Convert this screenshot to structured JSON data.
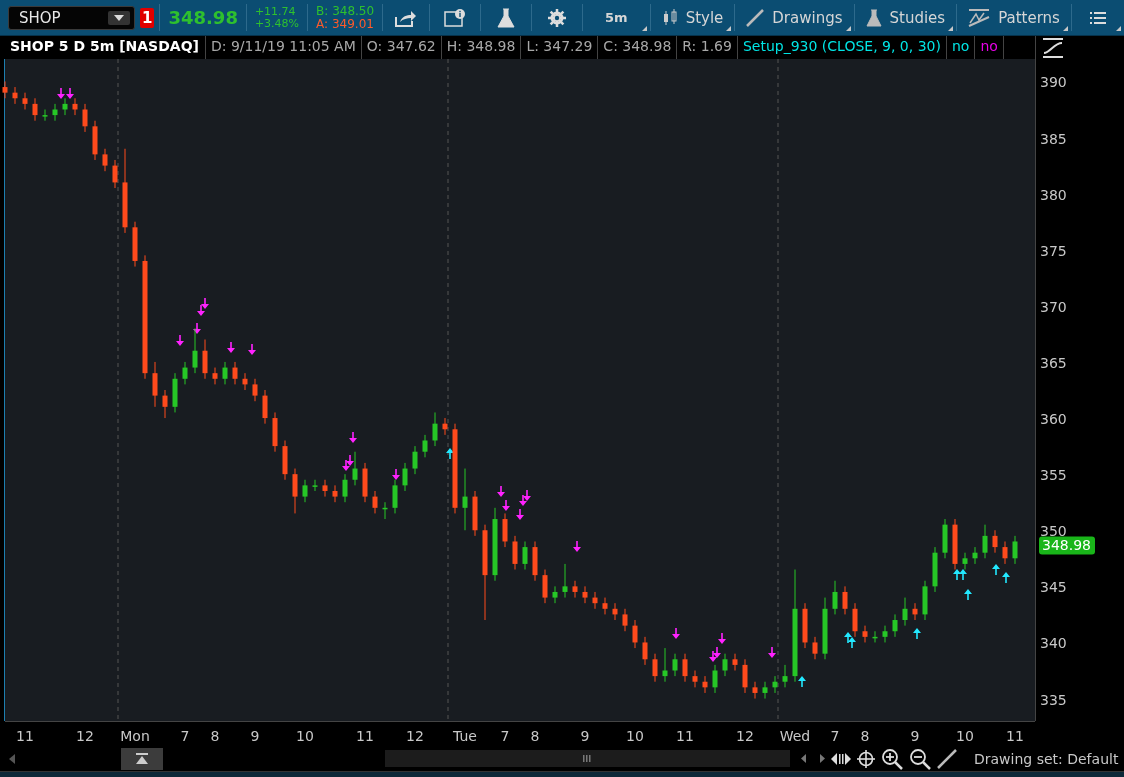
{
  "toolbar": {
    "symbol": "SHOP",
    "alert_count": "1",
    "last": "348.98",
    "change": "+11.74",
    "change_pct": "+3.48%",
    "bid": "B: 348.50",
    "ask": "A: 349.01",
    "aggregation": "5m",
    "menus": [
      {
        "label": "Style",
        "kind": "style"
      },
      {
        "label": "Drawings",
        "kind": "drawings"
      },
      {
        "label": "Studies",
        "kind": "studies"
      },
      {
        "label": "Patterns",
        "kind": "patterns"
      }
    ]
  },
  "header": {
    "title": "SHOP 5 D 5m [NASDAQ]",
    "fields": [
      {
        "text": "D: 9/11/19 11:05 AM",
        "kind": "quote"
      },
      {
        "text": "O: 347.62",
        "kind": "quote"
      },
      {
        "text": "H: 348.98",
        "kind": "quote"
      },
      {
        "text": "L: 347.29",
        "kind": "quote"
      },
      {
        "text": "C: 348.98",
        "kind": "quote"
      },
      {
        "text": "R: 1.69",
        "kind": "quote"
      },
      {
        "text": "Setup_930 (CLOSE, 9, 0, 30)",
        "kind": "study"
      },
      {
        "text": "no",
        "kind": "study"
      },
      {
        "text": "no",
        "kind": "signal"
      }
    ]
  },
  "chart": {
    "price_label": "348.98",
    "chart_data": {
      "type": "candlestick",
      "categories": [
        null,
        null,
        "11",
        null,
        null,
        null,
        null,
        null,
        "12",
        null,
        null,
        null,
        null,
        "Mon",
        null,
        null,
        null,
        null,
        "7",
        null,
        null,
        "8",
        null,
        null,
        null,
        "9",
        null,
        null,
        null,
        null,
        "10",
        null,
        null,
        null,
        null,
        null,
        "11",
        null,
        null,
        null,
        null,
        "12",
        null,
        null,
        null,
        null,
        "Tue",
        null,
        null,
        null,
        "7",
        null,
        null,
        "8",
        null,
        null,
        null,
        null,
        "9",
        null,
        null,
        null,
        null,
        "10",
        null,
        null,
        null,
        null,
        "11",
        null,
        null,
        null,
        null,
        null,
        "12",
        null,
        null,
        null,
        null,
        "Wed",
        null,
        null,
        null,
        "7",
        null,
        null,
        "8",
        null,
        null,
        null,
        null,
        "9",
        null,
        null,
        null,
        null,
        "10",
        null,
        null,
        null,
        null,
        "11"
      ],
      "ohlc": [
        [
          389.5,
          390,
          388.5,
          389
        ],
        [
          389,
          389.5,
          388,
          388.5
        ],
        [
          388.5,
          389,
          387.5,
          388
        ],
        [
          388,
          388.5,
          386.5,
          387
        ],
        [
          387,
          387.5,
          386.5,
          387
        ],
        [
          387,
          388,
          386.5,
          387.5
        ],
        [
          387.5,
          388.5,
          387,
          388
        ],
        [
          388,
          388.5,
          387,
          387.5
        ],
        [
          387.5,
          388,
          385.5,
          386
        ],
        [
          386,
          386.5,
          383,
          383.5
        ],
        [
          383.5,
          384,
          382,
          382.5
        ],
        [
          382.5,
          383,
          380.5,
          381
        ],
        [
          381,
          384,
          376.5,
          377
        ],
        [
          377,
          377.5,
          373.5,
          374
        ],
        [
          374,
          374.5,
          363.5,
          364
        ],
        [
          364,
          365,
          361,
          362
        ],
        [
          362,
          362.5,
          360,
          361
        ],
        [
          361,
          364,
          360.5,
          363.5
        ],
        [
          363.5,
          365,
          363,
          364.5
        ],
        [
          364.5,
          368,
          364,
          366
        ],
        [
          366,
          367,
          363.5,
          364
        ],
        [
          364,
          364.5,
          363,
          363.5
        ],
        [
          363.5,
          365,
          363,
          364.5
        ],
        [
          364.5,
          365,
          363,
          363.5
        ],
        [
          363.5,
          364,
          362.5,
          363
        ],
        [
          363,
          363.5,
          361.5,
          362
        ],
        [
          362,
          362.5,
          359.5,
          360
        ],
        [
          360,
          360.5,
          357,
          357.5
        ],
        [
          357.5,
          358,
          354.5,
          355
        ],
        [
          355,
          355.5,
          351.5,
          353
        ],
        [
          353,
          354.5,
          352.5,
          354
        ],
        [
          354,
          354.5,
          353.5,
          354
        ],
        [
          354,
          354.5,
          353,
          353.5
        ],
        [
          353.5,
          354,
          352.5,
          353
        ],
        [
          353,
          355,
          352.5,
          354.5
        ],
        [
          354.5,
          357,
          354,
          355.5
        ],
        [
          355.5,
          356,
          352.5,
          353
        ],
        [
          353,
          353.5,
          351.5,
          352
        ],
        [
          352,
          352.5,
          351,
          352
        ],
        [
          352,
          354.5,
          351.5,
          354
        ],
        [
          354,
          356,
          353.5,
          355.5
        ],
        [
          355.5,
          357.5,
          355,
          357
        ],
        [
          357,
          358.5,
          356.5,
          358
        ],
        [
          358,
          360.5,
          357.5,
          359.5
        ],
        [
          359.5,
          360,
          358.5,
          359
        ],
        [
          359,
          359.5,
          351.5,
          352
        ],
        [
          352,
          355.5,
          350,
          353
        ],
        [
          353,
          353.5,
          349.5,
          350
        ],
        [
          350,
          350.5,
          342,
          346
        ],
        [
          346,
          352,
          345.5,
          351
        ],
        [
          351,
          351.5,
          348.5,
          349
        ],
        [
          349,
          349.5,
          346.5,
          347
        ],
        [
          347,
          349,
          346.5,
          348.5
        ],
        [
          348.5,
          349,
          345.5,
          346
        ],
        [
          346,
          346.5,
          343.5,
          344
        ],
        [
          344,
          345,
          343.5,
          344.5
        ],
        [
          344.5,
          347,
          344,
          345
        ],
        [
          345,
          345.5,
          344,
          344.5
        ],
        [
          344.5,
          345,
          343.5,
          344
        ],
        [
          344,
          344.5,
          343,
          343.5
        ],
        [
          343.5,
          344,
          342.5,
          343
        ],
        [
          343,
          343.5,
          342,
          342.5
        ],
        [
          342.5,
          343,
          341,
          341.5
        ],
        [
          341.5,
          342,
          339.5,
          340
        ],
        [
          340,
          340.5,
          338,
          338.5
        ],
        [
          338.5,
          339,
          336.5,
          337
        ],
        [
          337,
          339.5,
          336.5,
          337.5
        ],
        [
          337.5,
          339,
          337,
          338.5
        ],
        [
          338.5,
          339,
          336.5,
          337
        ],
        [
          337,
          337.5,
          336,
          336.5
        ],
        [
          336.5,
          337,
          335.5,
          336
        ],
        [
          336,
          338,
          335.5,
          337.5
        ],
        [
          337.5,
          339,
          337,
          338.5
        ],
        [
          338.5,
          339,
          337.5,
          338
        ],
        [
          338,
          338.5,
          335.5,
          336
        ],
        [
          336,
          336.5,
          335,
          335.5
        ],
        [
          335.5,
          336.5,
          335,
          336
        ],
        [
          336,
          337,
          335.5,
          336.5
        ],
        [
          336.5,
          338,
          336,
          337
        ],
        [
          337,
          346.5,
          336.5,
          343
        ],
        [
          343,
          343.5,
          339.5,
          340
        ],
        [
          340,
          340.5,
          338.5,
          339
        ],
        [
          339,
          344,
          338.5,
          343
        ],
        [
          343,
          345.5,
          342.5,
          344.5
        ],
        [
          344.5,
          345,
          342.5,
          343
        ],
        [
          343,
          343.5,
          340.5,
          341
        ],
        [
          341,
          341.5,
          340,
          340.5
        ],
        [
          340.5,
          341,
          340,
          340.5
        ],
        [
          340.5,
          341.5,
          340,
          341
        ],
        [
          341,
          342.5,
          340.5,
          342
        ],
        [
          342,
          344,
          341.5,
          343
        ],
        [
          343,
          343.5,
          342,
          342.5
        ],
        [
          342.5,
          345.5,
          342,
          345
        ],
        [
          345,
          348.5,
          344.5,
          348
        ],
        [
          348,
          351,
          347.5,
          350.5
        ],
        [
          350.5,
          351,
          346.5,
          347
        ],
        [
          347,
          348,
          346.5,
          347.5
        ],
        [
          347.5,
          348.5,
          347,
          348
        ],
        [
          348,
          350.5,
          347.5,
          349.5
        ],
        [
          349.5,
          350,
          348,
          348.5
        ],
        [
          348.5,
          349,
          347,
          347.5
        ],
        [
          347.5,
          349.5,
          347,
          349
        ]
      ],
      "ylim": [
        333,
        392
      ],
      "yticks": [
        335,
        340,
        345,
        350,
        355,
        360,
        365,
        370,
        375,
        380,
        385,
        390
      ]
    }
  },
  "footer": {
    "drawing_set": "Drawing set: Default"
  }
}
